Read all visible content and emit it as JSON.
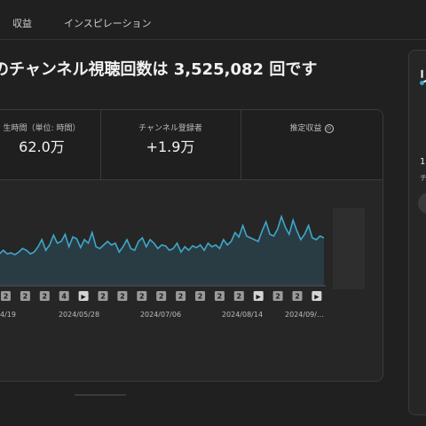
{
  "tabs": [
    {
      "label": "収益"
    },
    {
      "label": "インスピレーション"
    }
  ],
  "headline": "のチャンネル視聴回数は 3,525,082 回です",
  "metrics": [
    {
      "label": "生時間（単位: 時間）",
      "value": "62.0万"
    },
    {
      "label": "チャンネル登録者",
      "value": "+1.9万"
    },
    {
      "label": "推定収益",
      "value": ""
    }
  ],
  "sidebar": {
    "title": "リ",
    "number": "1",
    "subtitle": "チ"
  },
  "colors": {
    "line": "#3ea6c9",
    "fill": "#2c4650",
    "background": "#202020"
  },
  "chart_data": {
    "type": "line",
    "x_tick_labels": [
      "4/19",
      "2024/05/28",
      "2024/07/06",
      "2024/08/14",
      "2024/09/…"
    ],
    "markers": [
      "2",
      "2",
      "2",
      "4",
      "▶",
      "2",
      "2",
      "2",
      "2",
      "2",
      "2",
      "2",
      "2",
      "▶",
      "2",
      "2",
      "▶"
    ],
    "values": [
      38,
      36,
      40,
      36,
      37,
      35,
      38,
      42,
      40,
      36,
      38,
      44,
      52,
      40,
      46,
      57,
      48,
      50,
      58,
      44,
      55,
      53,
      43,
      52,
      48,
      60,
      44,
      42,
      46,
      50,
      46,
      48,
      38,
      44,
      52,
      42,
      40,
      50,
      54,
      44,
      52,
      48,
      42,
      46,
      45,
      40,
      42,
      48,
      38,
      44,
      40,
      45,
      43,
      46,
      40,
      48,
      44,
      46,
      42,
      52,
      46,
      50,
      60,
      55,
      68,
      56,
      54,
      52,
      50,
      62,
      72,
      58,
      56,
      64,
      78,
      66,
      58,
      74,
      62,
      52,
      58,
      68,
      54,
      52,
      56,
      54
    ]
  }
}
